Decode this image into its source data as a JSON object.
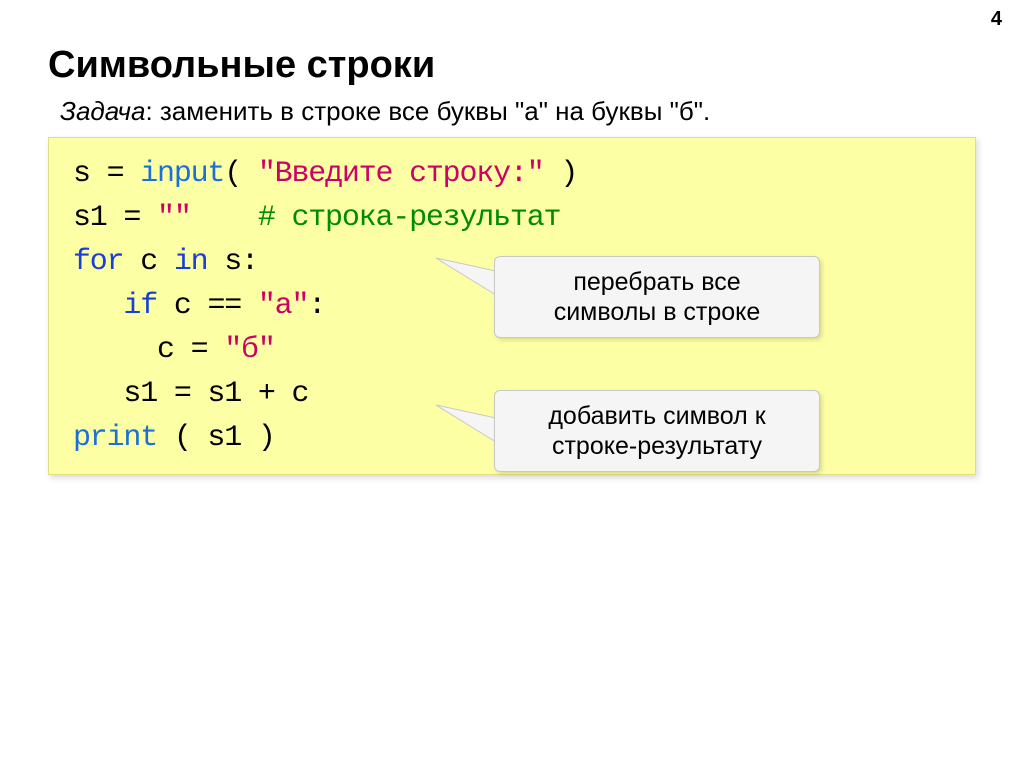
{
  "page_number": "4",
  "title": "Символьные строки",
  "task": {
    "label_italic": "Задача",
    "rest": ": заменить в строке все буквы \"а\" на буквы \"б\"."
  },
  "code": {
    "l1": {
      "a": "s = ",
      "b": "input",
      "c": "(",
      "d": " \"Введите строку:\" ",
      "e": ")"
    },
    "l2": {
      "a": "s1 = ",
      "b": "\"\"",
      "c": "    ",
      "d": "# строка-результат"
    },
    "l3": {
      "a": "for",
      "b": " c ",
      "c": "in",
      "d": " s:"
    },
    "l4": {
      "pad": "   ",
      "a": "if",
      "b": " c == ",
      "c": "\"а\"",
      "d": ":"
    },
    "l5": {
      "pad": "     ",
      "a": "c = ",
      "b": "\"б\""
    },
    "l6": {
      "pad": "   ",
      "a": "s1 = s1 + c"
    },
    "l7": {
      "a": "print",
      "b": " ( s1 )"
    }
  },
  "callouts": {
    "c1_line1": "перебрать все",
    "c1_line2": "символы в строке",
    "c2_line1": "добавить символ к",
    "c2_line2": "строке-результату"
  }
}
